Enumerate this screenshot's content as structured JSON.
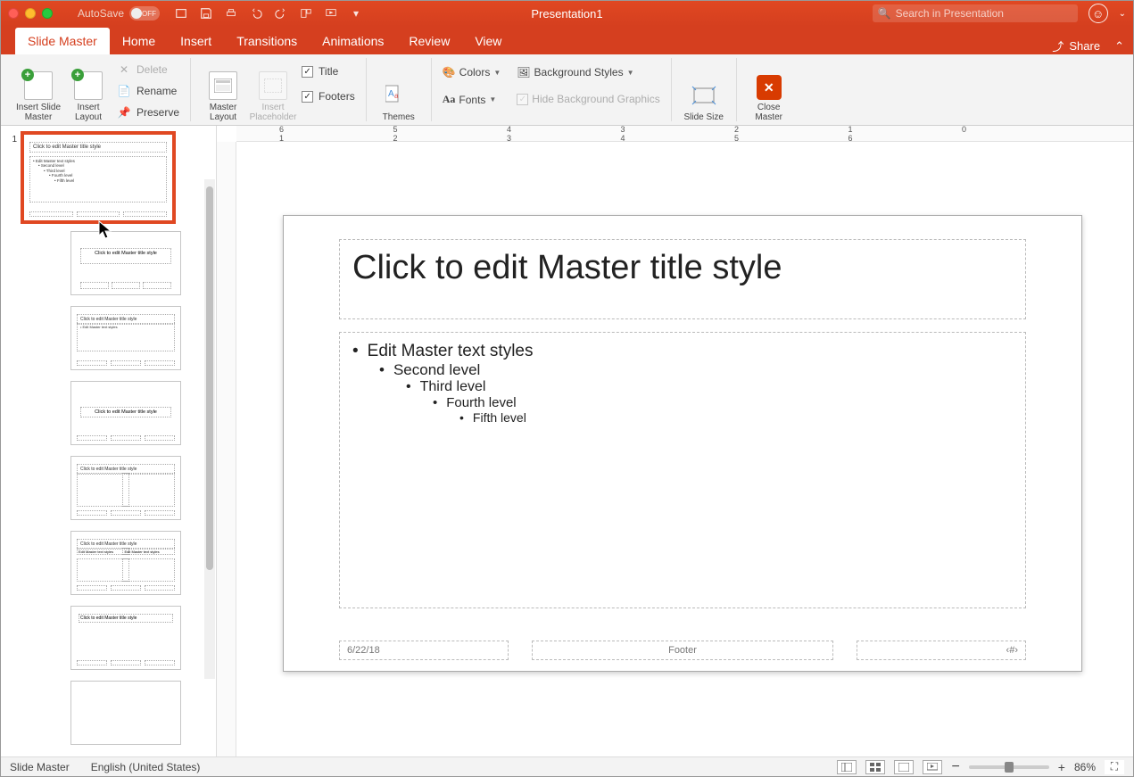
{
  "titlebar": {
    "autosave_label": "AutoSave",
    "autosave_state": "OFF",
    "doc_title": "Presentation1",
    "search_placeholder": "Search in Presentation"
  },
  "tabs": {
    "slide_master": "Slide Master",
    "home": "Home",
    "insert": "Insert",
    "transitions": "Transitions",
    "animations": "Animations",
    "review": "Review",
    "view": "View",
    "share": "Share"
  },
  "ribbon": {
    "insert_slide_master": "Insert Slide Master",
    "insert_layout": "Insert Layout",
    "delete": "Delete",
    "rename": "Rename",
    "preserve": "Preserve",
    "master_layout": "Master Layout",
    "insert_placeholder": "Insert Placeholder",
    "title_chk": "Title",
    "footers_chk": "Footers",
    "themes": "Themes",
    "colors": "Colors",
    "fonts": "Fonts",
    "bg_styles": "Background Styles",
    "hide_bg": "Hide Background Graphics",
    "slide_size": "Slide Size",
    "close_master": "Close Master"
  },
  "slide_panel": {
    "master_num": "1",
    "thumb_title": "Click to edit Master title style",
    "thumb_body_l1": "• Edit Master text styles",
    "thumb_body_l2": "• Second level",
    "thumb_body_l3": "• Third level",
    "thumb_body_l4": "• Fourth level",
    "thumb_body_l5": "• Fifth level"
  },
  "canvas": {
    "title_placeholder": "Click to edit Master title style",
    "body_l1": "Edit Master text styles",
    "body_l2": "Second level",
    "body_l3": "Third level",
    "body_l4": "Fourth level",
    "body_l5": "Fifth level",
    "date": "6/22/18",
    "footer": "Footer",
    "page_num": "‹#›"
  },
  "ruler_h": "6      5      4      3      2      1      0      1      2      3      4      5      6",
  "statusbar": {
    "mode": "Slide Master",
    "lang": "English (United States)",
    "zoom": "86%",
    "minus": "−",
    "plus": "+"
  }
}
